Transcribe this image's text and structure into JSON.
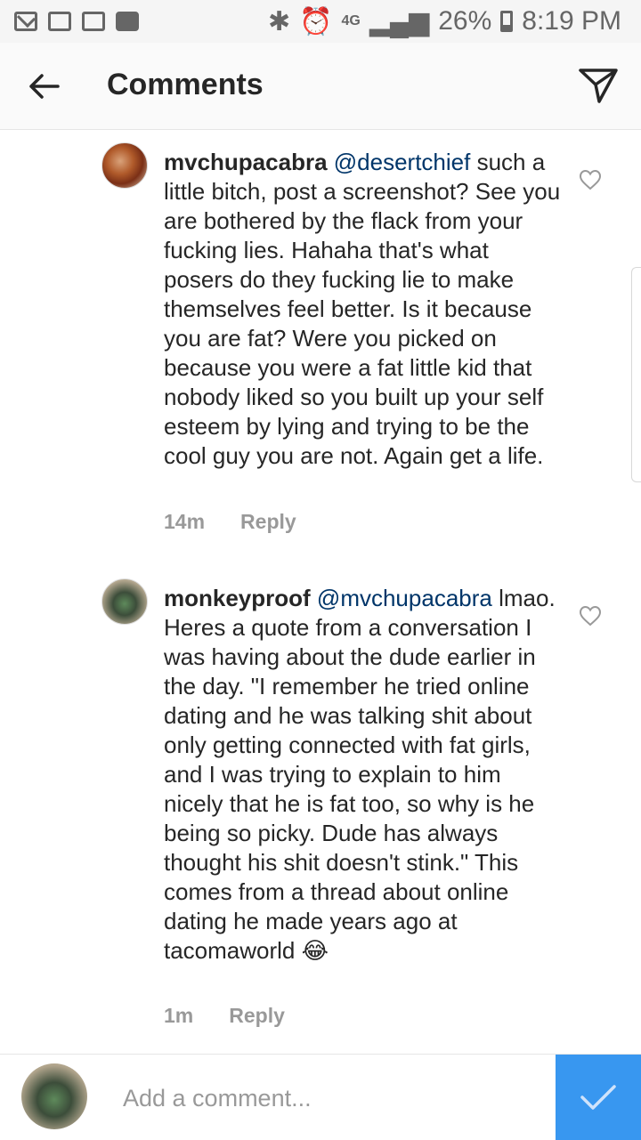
{
  "status_bar": {
    "network": "4G",
    "battery": "26%",
    "time": "8:19 PM"
  },
  "header": {
    "title": "Comments"
  },
  "comments": [
    {
      "username": "mvchupacabra",
      "mention": "@desertchief",
      "text": "such a little bitch, post a screenshot? See you are bothered by the flack from your fucking lies. Hahaha that's what posers do they fucking lie to make themselves feel better. Is it because you are fat? Were you picked on because you were a fat little kid that nobody liked so you built up your self esteem by lying and trying to be the cool guy you are not. Again get a life.",
      "time": "14m",
      "reply_label": "Reply"
    },
    {
      "username": "monkeyproof",
      "mention": "@mvchupacabra",
      "text": "lmao. Heres a  quote from a conversation I was having about the dude earlier in the day. \"I remember he tried online dating and he was talking shit about only getting connected with fat girls, and I was trying to explain to him nicely that he is fat too, so why is he being so picky. Dude has always thought his shit doesn't stink.\" This comes from a thread about online dating he made years ago at tacomaworld",
      "emoji": "😂",
      "time": "1m",
      "reply_label": "Reply"
    }
  ],
  "composer": {
    "placeholder": "Add a comment..."
  },
  "icons": {
    "back": "arrow-left-icon",
    "send": "paper-plane-icon",
    "like": "heart-outline-icon",
    "post": "checkmark-icon"
  },
  "colors": {
    "mention": "#003569",
    "post_button": "#3897f0",
    "muted": "#999999"
  }
}
